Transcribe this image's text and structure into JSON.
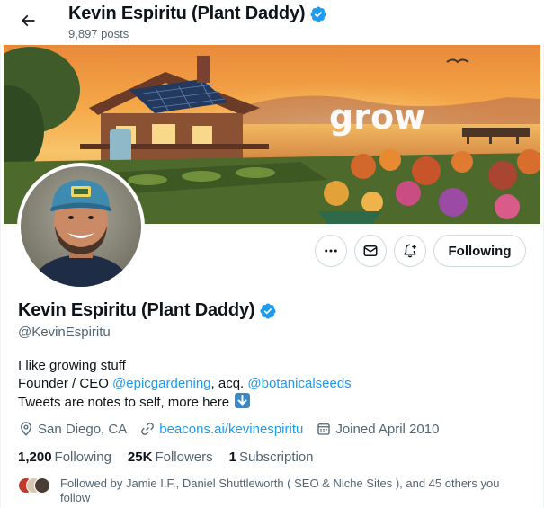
{
  "header": {
    "name": "Kevin Espiritu (Plant Daddy)",
    "post_count": "9,897 posts"
  },
  "banner": {
    "text": "grow"
  },
  "actions": {
    "more_icon": "more-icon",
    "message_icon": "envelope-icon",
    "notify_icon": "bell-plus-icon",
    "follow_label": "Following"
  },
  "profile": {
    "name": "Kevin Espiritu (Plant Daddy)",
    "handle": "@KevinEspiritu",
    "bio": {
      "line1": "I like growing stuff",
      "line2_prefix": "Founder / CEO ",
      "line2_mention1": "@epicgardening",
      "line2_middle": ", acq. ",
      "line2_mention2": "@botanicalseeds",
      "line3": "Tweets are notes to self, more here"
    },
    "location": "San Diego, CA",
    "website": "beacons.ai/kevinespiritu",
    "joined": "Joined April 2010"
  },
  "stats": {
    "following_count": "1,200",
    "following_label": "Following",
    "followers_count": "25K",
    "followers_label": "Followers",
    "subscriptions_count": "1",
    "subscriptions_label": "Subscription"
  },
  "followed_by": {
    "text": "Followed by Jamie I.F., Daniel Shuttleworth ( SEO & Niche Sites ), and 45 others you follow"
  },
  "colors": {
    "accent": "#1d9bf0",
    "verified": "#1d9bf0",
    "muted": "#536471",
    "text": "#0f1419",
    "border": "#cfd9de"
  }
}
